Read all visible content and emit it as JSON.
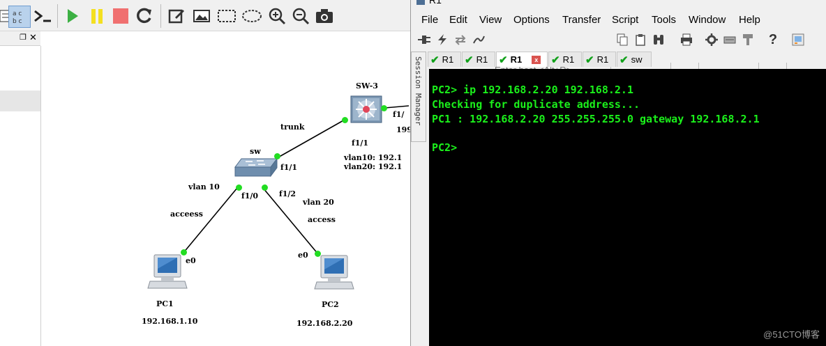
{
  "crt": {
    "window_title": "R1",
    "menu": [
      "File",
      "Edit",
      "View",
      "Options",
      "Transfer",
      "Script",
      "Tools",
      "Window",
      "Help"
    ],
    "host_placeholder": "Enter host <Alt+R>",
    "session_manager_label": "Session Manager",
    "tabs": [
      {
        "label": "R1",
        "status": "connected"
      },
      {
        "label": "R1",
        "status": "connected"
      },
      {
        "label": "R1",
        "status": "connected",
        "active": true
      },
      {
        "label": "R1",
        "status": "connected"
      },
      {
        "label": "R1",
        "status": "connected"
      },
      {
        "label": "sw",
        "status": "connected"
      }
    ],
    "tab_close_glyph": "x",
    "terminal": [
      "PC2> ip 192.168.2.20 192.168.2.1",
      "Checking for duplicate address...",
      "PC1 : 192.168.2.20 255.255.255.0 gateway 192.168.2.1",
      "",
      "PC2>"
    ],
    "terminal_text_color": "#1bf01b",
    "terminal_bg_color": "#000000"
  },
  "topology": {
    "sw3_name": "SW-3",
    "sw_name": "sw",
    "trunk_label": "trunk",
    "sw3_port_f11": "f1/1",
    "sw3_port_partial": "f1/",
    "sw3_partial_ip": "199",
    "vlan10_if": "vlan10: 192.1",
    "vlan20_if": "vlan20: 192.1",
    "sw_port_f11": "f1/1",
    "sw_port_f10": "f1/0",
    "sw_port_f12": "f1/2",
    "vlan10_label": "vlan 10",
    "vlan20_label": "vlan 20",
    "access_left": "acceess",
    "access_right": "access",
    "pc1_port": "e0",
    "pc2_port": "e0",
    "pc1_name": "PC1",
    "pc2_name": "PC2",
    "pc1_ip": "192.168.1.10",
    "pc2_ip": "192.168.2.20"
  },
  "watermark": "@51CTO博客"
}
